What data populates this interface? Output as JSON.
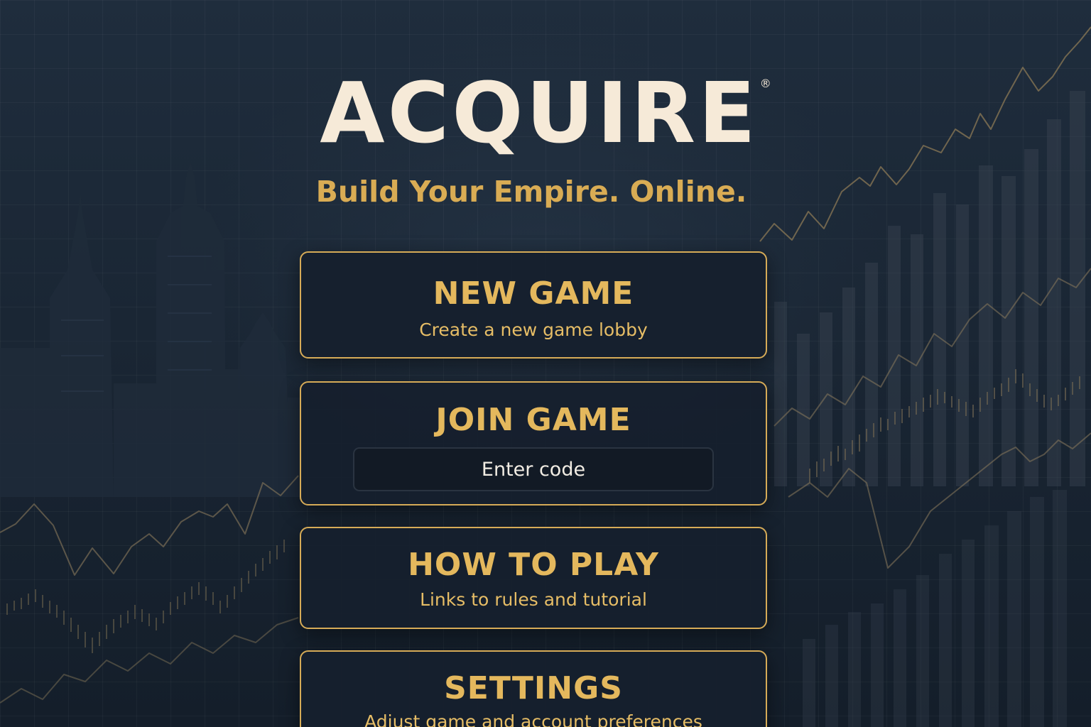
{
  "brand": {
    "title": "ACQUIRE",
    "registered_mark": "®",
    "tagline": "Build Your Empire. Online."
  },
  "menu": {
    "new_game": {
      "title": "NEW GAME",
      "subtitle": "Create a new game lobby"
    },
    "join_game": {
      "title": "JOIN GAME",
      "code_placeholder": "Enter code"
    },
    "how_to_play": {
      "title": "HOW TO PLAY",
      "subtitle": "Links to rules and tutorial"
    },
    "settings": {
      "title": "SETTINGS",
      "subtitle": "Adjust game and account preferences"
    }
  },
  "colors": {
    "background": "#1b2838",
    "gold_accent": "#d6ab57",
    "logo_cream": "#f6ead8",
    "card_background": "#151f2d"
  },
  "background_art": {
    "skyline": "city-skyline-silhouette",
    "charts": "stock-market-line-and-bar-charts"
  }
}
